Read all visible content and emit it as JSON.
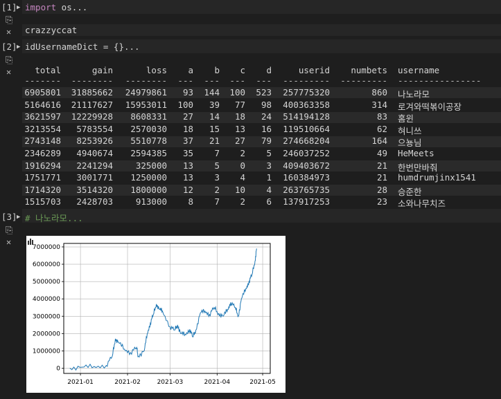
{
  "cells": [
    {
      "label": "[1]",
      "code_keyword": "import",
      "code_rest": " os...",
      "output": "crazzyccat"
    },
    {
      "label": "[2]",
      "code": "idUsernameDict = {}..."
    },
    {
      "label": "[3]",
      "code": "# 나노라모..."
    }
  ],
  "table": {
    "headers": [
      "total",
      "gain",
      "loss",
      "a",
      "b",
      "c",
      "d",
      "userid",
      "numbets",
      "username"
    ],
    "separators": [
      "-------",
      "--------",
      "--------",
      "---",
      "---",
      "---",
      "---",
      "---------",
      "---------",
      "----------------"
    ],
    "rows": [
      [
        "6905801",
        "31885662",
        "24979861",
        "93",
        "144",
        "100",
        "523",
        "257775320",
        "860",
        "나노라모"
      ],
      [
        "5164616",
        "21117627",
        "15953011",
        "100",
        "39",
        "77",
        "98",
        "400363358",
        "314",
        "로겨와떡볶이공장"
      ],
      [
        "3621597",
        "12229928",
        "8608331",
        "27",
        "14",
        "18",
        "24",
        "514194128",
        "83",
        "홈윈"
      ],
      [
        "3213554",
        "5783554",
        "2570030",
        "18",
        "15",
        "13",
        "16",
        "119510664",
        "62",
        "혀니쓰"
      ],
      [
        "2743148",
        "8253926",
        "5510778",
        "37",
        "21",
        "27",
        "79",
        "274668204",
        "164",
        "으뇽님"
      ],
      [
        "2346289",
        "4940674",
        "2594385",
        "35",
        "7",
        "2",
        "5",
        "246037252",
        "49",
        "HeMeets"
      ],
      [
        "1916294",
        "2241294",
        "325000",
        "13",
        "5",
        "0",
        "3",
        "409403672",
        "21",
        "한번만바줘"
      ],
      [
        "1751771",
        "3001771",
        "1250000",
        "13",
        "3",
        "4",
        "1",
        "160384973",
        "21",
        "humdrumjinx1541"
      ],
      [
        "1714320",
        "3514320",
        "1800000",
        "12",
        "2",
        "10",
        "4",
        "263765735",
        "28",
        "승준한"
      ],
      [
        "1515703",
        "2428703",
        "913000",
        "8",
        "7",
        "2",
        "6",
        "137917253",
        "23",
        "소와나무치즈"
      ]
    ]
  },
  "icons": {
    "paste": "clipboard-icon",
    "close": "close-icon",
    "run_arrow": "triangle-right-icon",
    "chart": "bar-chart-icon"
  },
  "chart_data": {
    "type": "line",
    "title": "",
    "xlabel": "",
    "ylabel": "",
    "color": "#1f77b4",
    "x_ticks": [
      "2021-01",
      "2021-02",
      "2021-03",
      "2021-04",
      "2021-05"
    ],
    "y_ticks": [
      "0",
      "1000000",
      "2000000",
      "3000000",
      "4000000",
      "5000000",
      "6000000",
      "7000000"
    ],
    "xlim": [
      "2020-12-21",
      "2021-05-06"
    ],
    "ylim": [
      -300000,
      7200000
    ],
    "grid": true,
    "series": [
      {
        "x": [
          "2020-12-25",
          "2021-01-02",
          "2021-01-10",
          "2021-01-18",
          "2021-01-22",
          "2021-01-24",
          "2021-01-26",
          "2021-01-30",
          "2021-02-03",
          "2021-02-07",
          "2021-02-08",
          "2021-02-12",
          "2021-02-14",
          "2021-02-16",
          "2021-02-18",
          "2021-02-20",
          "2021-02-22",
          "2021-02-24",
          "2021-03-01",
          "2021-03-04",
          "2021-03-06",
          "2021-03-08",
          "2021-03-11",
          "2021-03-14",
          "2021-03-16",
          "2021-03-18",
          "2021-03-21",
          "2021-03-24",
          "2021-03-27",
          "2021-03-30",
          "2021-04-02",
          "2021-04-05",
          "2021-04-08",
          "2021-04-10",
          "2021-04-13",
          "2021-04-15",
          "2021-04-17",
          "2021-04-20",
          "2021-04-22",
          "2021-04-24",
          "2021-04-26",
          "2021-04-27"
        ],
        "y": [
          10000,
          60000,
          100000,
          160000,
          700000,
          1700000,
          1500000,
          1100000,
          900000,
          1200000,
          700000,
          1000000,
          2000000,
          2600000,
          3100000,
          3700000,
          3400000,
          3300000,
          2400000,
          2200000,
          2500000,
          2000000,
          1950000,
          2250000,
          1800000,
          2200000,
          3200000,
          3300000,
          3100000,
          3500000,
          3150000,
          3000000,
          3400000,
          3800000,
          3500000,
          3000000,
          4000000,
          4600000,
          5000000,
          5400000,
          6200000,
          6905801
        ]
      }
    ]
  }
}
